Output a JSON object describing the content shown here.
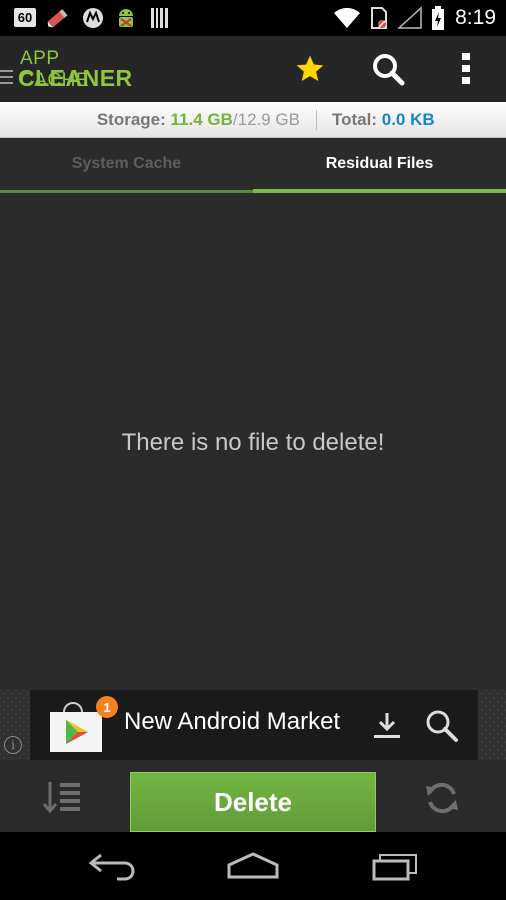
{
  "status_bar": {
    "badge": "60",
    "time": "8:19",
    "icons": [
      "notification-pen-icon",
      "motorola-icon",
      "android-debug-icon",
      "barcode-icon",
      "wifi-icon",
      "sim-blocked-icon",
      "signal-icon",
      "battery-charging-icon"
    ]
  },
  "app": {
    "logo_line1": "APP CACHE",
    "logo_line2": "CLEANER",
    "actions": [
      "star-icon",
      "search-icon",
      "overflow-menu-icon"
    ]
  },
  "storage": {
    "storage_label": "Storage:",
    "used": "11.4 GB",
    "separator": "/",
    "total_storage": "12.9 GB",
    "total_label": "Total:",
    "total_value": "0.0 KB"
  },
  "tabs": [
    {
      "label": "System Cache",
      "active": false
    },
    {
      "label": "Residual Files",
      "active": true
    }
  ],
  "content": {
    "empty_message": "There is no file to delete!"
  },
  "ad": {
    "badge_count": "1",
    "title": "New Android Market",
    "info_icon": "info-icon",
    "icons": [
      "play-store-bag-icon",
      "download-icon",
      "search-icon"
    ]
  },
  "bottom": {
    "delete_label": "Delete",
    "icons": [
      "sort-icon",
      "refresh-icon"
    ]
  },
  "nav": [
    "back-icon",
    "home-icon",
    "recent-apps-icon"
  ],
  "colors": {
    "accent_green": "#78c043",
    "storage_green": "#75b33a",
    "total_blue": "#1a86c9",
    "star_yellow": "#ffd600",
    "ad_badge_orange": "#f58220"
  }
}
